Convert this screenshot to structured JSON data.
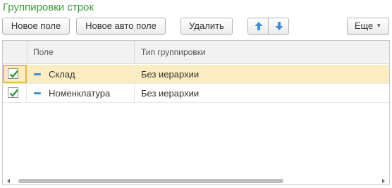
{
  "panel": {
    "title": "Группировки строк"
  },
  "toolbar": {
    "add_field_label": "Новое поле",
    "add_auto_field_label": "Новое авто поле",
    "delete_label": "Удалить",
    "up_icon": "arrow-up-icon",
    "down_icon": "arrow-down-icon",
    "more_label": "Еще"
  },
  "grid": {
    "columns": [
      "Поле",
      "Тип группировки"
    ],
    "rows": [
      {
        "checked": true,
        "field": "Склад",
        "type": "Без иерархии",
        "selected": true
      },
      {
        "checked": true,
        "field": "Номенклатура",
        "type": "Без иерархии",
        "selected": false
      }
    ]
  },
  "colors": {
    "title": "#3a9a3a",
    "selected_row": "#fbedbf",
    "check": "#2e9b45",
    "arrow": "#3b8ee0"
  }
}
